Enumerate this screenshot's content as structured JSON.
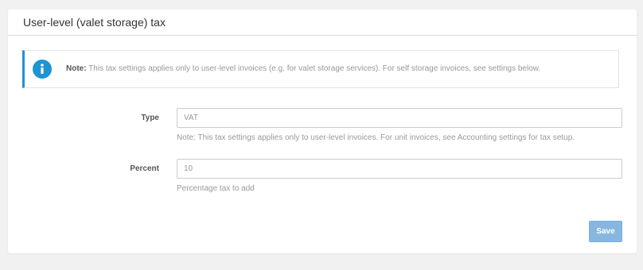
{
  "panel": {
    "title": "User-level (valet storage) tax"
  },
  "note": {
    "icon": "info-icon",
    "label": "Note:",
    "text": "This tax settings applies only to user-level invoices (e.g. for valet storage services). For self storage invoices, see settings below."
  },
  "form": {
    "type": {
      "label": "Type",
      "value": "VAT",
      "help": "Note: This tax settings applies only to user-level invoices. For unit invoices, see Accounting settings for tax setup."
    },
    "percent": {
      "label": "Percent",
      "value": "10",
      "help": "Percentage tax to add"
    },
    "save_label": "Save"
  },
  "colors": {
    "accent": "#1e94d2",
    "save_button": "#87b7e0",
    "background": "#f1f1f1"
  }
}
